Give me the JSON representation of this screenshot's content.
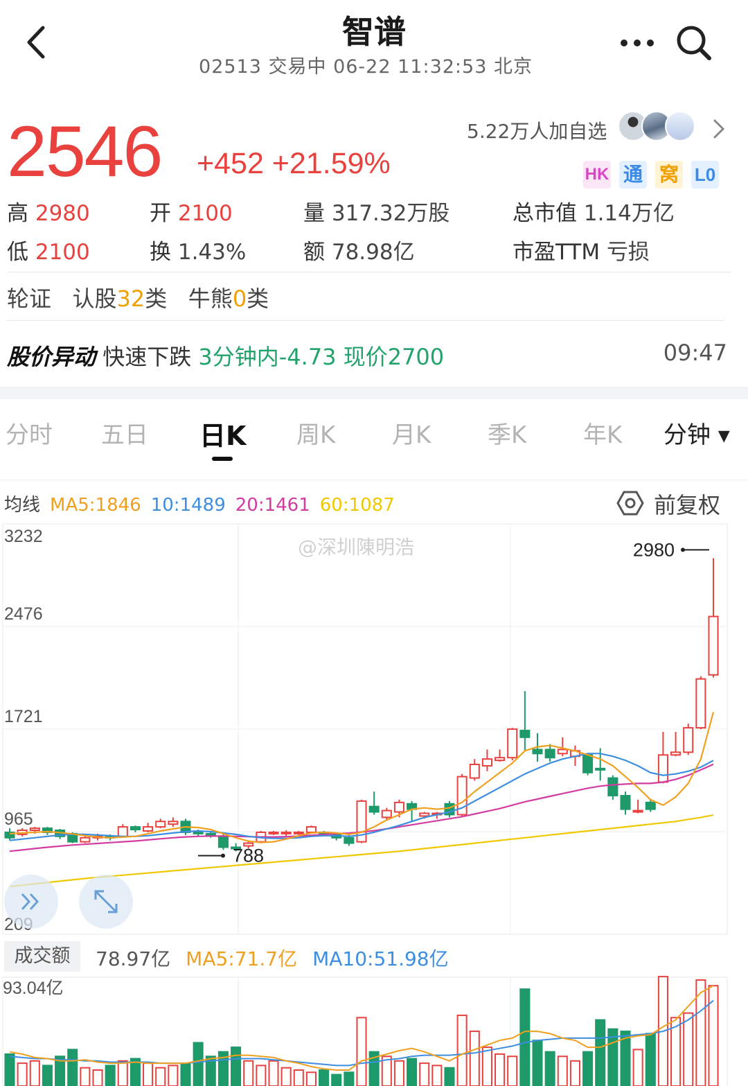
{
  "header": {
    "title": "智谱",
    "subtitle": "02513 交易中  06-22 11:32:53  北京"
  },
  "quote": {
    "price": "2546",
    "change": "+452 +21.59%",
    "followers": "5.22万人加自选",
    "badges": [
      "HK",
      "通",
      "窝",
      "L0"
    ],
    "stats": {
      "high_label": "高",
      "high": "2980",
      "open_label": "开",
      "open": "2100",
      "volume_label": "量",
      "volume": "317.32万股",
      "mktcap_label": "总市值",
      "mktcap": "1.14万亿",
      "low_label": "低",
      "low": "2100",
      "turnover_label": "换",
      "turnover": "1.43%",
      "amount_label": "额",
      "amount": "78.98亿",
      "pe_label": "市盈TTM",
      "pe": "亏损"
    }
  },
  "warrants": {
    "label": "轮证",
    "call_prefix": "认股",
    "call_count": "32",
    "call_suffix": "类",
    "cbbc_prefix": "牛熊",
    "cbbc_count": "0",
    "cbbc_suffix": "类"
  },
  "alert": {
    "title": "股价异动",
    "text": "快速下跌",
    "detail": "3分钟内-4.73 现价2700",
    "time": "09:47"
  },
  "tabs": [
    "分时",
    "五日",
    "日K",
    "周K",
    "月K",
    "季K",
    "年K",
    "分钟 ▾"
  ],
  "active_tab": "日K",
  "ma": {
    "label": "均线",
    "ma5": "MA5:1846",
    "ma10": "10:1489",
    "ma20": "20:1461",
    "ma60": "60:1087",
    "adjust": "前复权"
  },
  "watermark": "@深圳陳明浩",
  "volume": {
    "tag": "成交额",
    "value": "78.97亿",
    "ma5": "MA5:71.7亿",
    "ma10": "MA10:51.98亿",
    "ymax_label": "93.04亿"
  },
  "colors": {
    "up": "#e8413e",
    "down": "#1e9a6a",
    "ma5": "#f0a020",
    "ma10": "#3d8ee0",
    "ma20": "#d23ca0",
    "ma60": "#f0c800"
  },
  "chart_data": {
    "type": "candlestick",
    "y_ticks": [
      "3232",
      "2476",
      "1721",
      "965",
      "209"
    ],
    "ylim": [
      209,
      3232
    ],
    "high_marker": "2980",
    "low_marker": "788",
    "candles": [
      {
        "o": 960,
        "c": 920,
        "h": 990,
        "l": 900
      },
      {
        "o": 945,
        "c": 975,
        "h": 990,
        "l": 930
      },
      {
        "o": 975,
        "c": 990,
        "h": 1000,
        "l": 950
      },
      {
        "o": 990,
        "c": 960,
        "h": 1000,
        "l": 940
      },
      {
        "o": 975,
        "c": 930,
        "h": 985,
        "l": 910
      },
      {
        "o": 950,
        "c": 890,
        "h": 960,
        "l": 880
      },
      {
        "o": 890,
        "c": 920,
        "h": 940,
        "l": 880
      },
      {
        "o": 920,
        "c": 930,
        "h": 950,
        "l": 900
      },
      {
        "o": 930,
        "c": 920,
        "h": 945,
        "l": 900
      },
      {
        "o": 930,
        "c": 1000,
        "h": 1020,
        "l": 920
      },
      {
        "o": 1000,
        "c": 980,
        "h": 1010,
        "l": 960
      },
      {
        "o": 970,
        "c": 1000,
        "h": 1030,
        "l": 960
      },
      {
        "o": 1000,
        "c": 1040,
        "h": 1060,
        "l": 990
      },
      {
        "o": 1020,
        "c": 1040,
        "h": 1070,
        "l": 1000
      },
      {
        "o": 1040,
        "c": 960,
        "h": 1060,
        "l": 940
      },
      {
        "o": 960,
        "c": 950,
        "h": 980,
        "l": 930
      },
      {
        "o": 950,
        "c": 940,
        "h": 960,
        "l": 920
      },
      {
        "o": 930,
        "c": 850,
        "h": 950,
        "l": 830
      },
      {
        "o": 850,
        "c": 840,
        "h": 880,
        "l": 820
      },
      {
        "o": 860,
        "c": 880,
        "h": 900,
        "l": 840
      },
      {
        "o": 890,
        "c": 960,
        "h": 970,
        "l": 880
      },
      {
        "o": 960,
        "c": 960,
        "h": 970,
        "l": 940
      },
      {
        "o": 950,
        "c": 960,
        "h": 975,
        "l": 930
      },
      {
        "o": 960,
        "c": 960,
        "h": 970,
        "l": 940
      },
      {
        "o": 960,
        "c": 1000,
        "h": 1010,
        "l": 950
      },
      {
        "o": 960,
        "c": 950,
        "h": 970,
        "l": 940
      },
      {
        "o": 940,
        "c": 920,
        "h": 960,
        "l": 900
      },
      {
        "o": 920,
        "c": 880,
        "h": 940,
        "l": 860
      },
      {
        "o": 890,
        "c": 1190,
        "h": 1200,
        "l": 880
      },
      {
        "o": 1150,
        "c": 1110,
        "h": 1260,
        "l": 1090
      },
      {
        "o": 1070,
        "c": 1120,
        "h": 1140,
        "l": 1050
      },
      {
        "o": 1110,
        "c": 1180,
        "h": 1200,
        "l": 1070
      },
      {
        "o": 1170,
        "c": 1130,
        "h": 1190,
        "l": 1040
      },
      {
        "o": 1080,
        "c": 1100,
        "h": 1110,
        "l": 1060
      },
      {
        "o": 1100,
        "c": 1100,
        "h": 1110,
        "l": 1060
      },
      {
        "o": 1170,
        "c": 1090,
        "h": 1190,
        "l": 1070
      },
      {
        "o": 1090,
        "c": 1370,
        "h": 1390,
        "l": 1080
      },
      {
        "o": 1360,
        "c": 1460,
        "h": 1500,
        "l": 1340
      },
      {
        "o": 1450,
        "c": 1500,
        "h": 1570,
        "l": 1410
      },
      {
        "o": 1490,
        "c": 1510,
        "h": 1570,
        "l": 1480
      },
      {
        "o": 1510,
        "c": 1720,
        "h": 1730,
        "l": 1490
      },
      {
        "o": 1710,
        "c": 1660,
        "h": 2000,
        "l": 1560
      },
      {
        "o": 1570,
        "c": 1540,
        "h": 1690,
        "l": 1480
      },
      {
        "o": 1570,
        "c": 1510,
        "h": 1610,
        "l": 1480
      },
      {
        "o": 1540,
        "c": 1570,
        "h": 1660,
        "l": 1520
      },
      {
        "o": 1520,
        "c": 1560,
        "h": 1600,
        "l": 1450
      },
      {
        "o": 1530,
        "c": 1400,
        "h": 1540,
        "l": 1380
      },
      {
        "o": 1430,
        "c": 1420,
        "h": 1580,
        "l": 1340
      },
      {
        "o": 1360,
        "c": 1230,
        "h": 1380,
        "l": 1200
      },
      {
        "o": 1230,
        "c": 1130,
        "h": 1260,
        "l": 1090
      },
      {
        "o": 1110,
        "c": 1120,
        "h": 1200,
        "l": 1100
      },
      {
        "o": 1180,
        "c": 1130,
        "h": 1200,
        "l": 1110
      },
      {
        "o": 1330,
        "c": 1530,
        "h": 1700,
        "l": 1320
      },
      {
        "o": 1530,
        "c": 1550,
        "h": 1700,
        "l": 1520
      },
      {
        "o": 1550,
        "c": 1730,
        "h": 1760,
        "l": 1530
      },
      {
        "o": 1730,
        "c": 2090,
        "h": 2110,
        "l": 1720
      },
      {
        "o": 2120,
        "c": 2550,
        "h": 2980,
        "l": 2100
      }
    ],
    "ma5": [
      950,
      955,
      960,
      965,
      958,
      948,
      935,
      925,
      920,
      925,
      930,
      950,
      970,
      985,
      1000,
      995,
      980,
      950,
      920,
      895,
      885,
      890,
      910,
      935,
      955,
      960,
      955,
      945,
      960,
      1000,
      1050,
      1090,
      1130,
      1140,
      1130,
      1140,
      1180,
      1260,
      1330,
      1400,
      1470,
      1560,
      1590,
      1600,
      1580,
      1560,
      1530,
      1500,
      1450,
      1370,
      1290,
      1200,
      1160,
      1220,
      1320,
      1500,
      1846
    ],
    "ma10": [
      900,
      910,
      920,
      930,
      940,
      945,
      945,
      940,
      935,
      930,
      930,
      935,
      945,
      955,
      965,
      970,
      965,
      955,
      945,
      930,
      920,
      915,
      915,
      920,
      930,
      935,
      935,
      930,
      940,
      960,
      985,
      1010,
      1040,
      1070,
      1090,
      1110,
      1140,
      1190,
      1240,
      1290,
      1340,
      1390,
      1430,
      1470,
      1500,
      1520,
      1540,
      1540,
      1520,
      1490,
      1450,
      1400,
      1380,
      1390,
      1410,
      1440,
      1489
    ],
    "ma20": [
      820,
      830,
      840,
      850,
      858,
      866,
      872,
      878,
      884,
      890,
      896,
      904,
      912,
      920,
      926,
      930,
      932,
      932,
      930,
      928,
      926,
      926,
      928,
      932,
      938,
      944,
      950,
      954,
      962,
      972,
      985,
      1000,
      1015,
      1030,
      1045,
      1060,
      1075,
      1095,
      1115,
      1135,
      1160,
      1185,
      1205,
      1225,
      1245,
      1265,
      1285,
      1300,
      1310,
      1315,
      1320,
      1320,
      1330,
      1350,
      1380,
      1420,
      1461
    ],
    "ma60": [
      560,
      570,
      580,
      590,
      600,
      610,
      620,
      628,
      636,
      644,
      652,
      660,
      668,
      676,
      684,
      692,
      700,
      708,
      716,
      724,
      732,
      740,
      748,
      756,
      764,
      772,
      780,
      788,
      796,
      804,
      812,
      820,
      830,
      840,
      850,
      860,
      870,
      880,
      890,
      900,
      910,
      920,
      930,
      940,
      950,
      960,
      970,
      980,
      990,
      1000,
      1010,
      1020,
      1030,
      1040,
      1055,
      1070,
      1087
    ],
    "volume": {
      "ymax": 93.04,
      "values": [
        28,
        20,
        22,
        18,
        26,
        32,
        16,
        14,
        18,
        22,
        24,
        20,
        16,
        18,
        20,
        38,
        26,
        30,
        34,
        22,
        18,
        22,
        16,
        14,
        12,
        14,
        10,
        12,
        60,
        30,
        26,
        22,
        24,
        20,
        18,
        16,
        62,
        48,
        34,
        28,
        26,
        85,
        40,
        30,
        26,
        22,
        30,
        58,
        50,
        48,
        32,
        46,
        96,
        60,
        64,
        93,
        88
      ],
      "ma5": [
        30,
        28,
        25,
        24,
        22,
        22,
        23,
        21,
        20,
        20,
        21,
        20,
        20,
        20,
        20,
        22,
        24,
        25,
        27,
        27,
        26,
        25,
        22,
        20,
        17,
        15,
        14,
        14,
        22,
        25,
        28,
        31,
        33,
        30,
        26,
        22,
        28,
        32,
        36,
        40,
        42,
        48,
        48,
        46,
        42,
        40,
        34,
        34,
        38,
        42,
        44,
        45,
        52,
        58,
        70,
        82,
        88
      ],
      "ma10": [
        26,
        25,
        24,
        24,
        23,
        23,
        22,
        22,
        21,
        21,
        21,
        21,
        20,
        20,
        20,
        21,
        22,
        23,
        24,
        24,
        24,
        23,
        22,
        21,
        20,
        19,
        18,
        18,
        20,
        21,
        23,
        24,
        26,
        27,
        27,
        27,
        28,
        29,
        31,
        33,
        35,
        38,
        40,
        41,
        42,
        42,
        42,
        42,
        43,
        44,
        45,
        46,
        48,
        52,
        58,
        66,
        75
      ]
    }
  }
}
